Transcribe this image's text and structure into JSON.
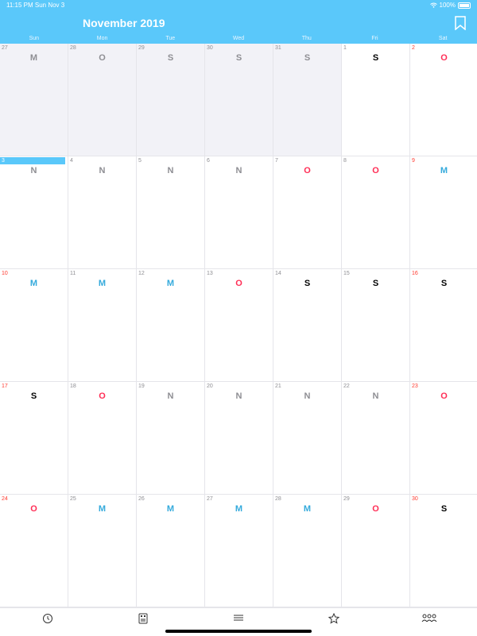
{
  "status": {
    "time": "11:15 PM   Sun Nov 3",
    "battery": "100%"
  },
  "header": {
    "title": "November 2019"
  },
  "weekdays": [
    "Sun",
    "Mon",
    "Tue",
    "Wed",
    "Thu",
    "Fri",
    "Sat"
  ],
  "weeks": [
    [
      {
        "day": "27",
        "shift": "M",
        "prev": true
      },
      {
        "day": "28",
        "shift": "O",
        "prev": true
      },
      {
        "day": "29",
        "shift": "S",
        "prev": true
      },
      {
        "day": "30",
        "shift": "S",
        "prev": true
      },
      {
        "day": "31",
        "shift": "S",
        "prev": true
      },
      {
        "day": "1",
        "shift": "S"
      },
      {
        "day": "2",
        "shift": "O",
        "weekend": true
      }
    ],
    [
      {
        "day": "3",
        "shift": "N",
        "today": true
      },
      {
        "day": "4",
        "shift": "N"
      },
      {
        "day": "5",
        "shift": "N"
      },
      {
        "day": "6",
        "shift": "N"
      },
      {
        "day": "7",
        "shift": "O"
      },
      {
        "day": "8",
        "shift": "O"
      },
      {
        "day": "9",
        "shift": "M",
        "weekend": true
      }
    ],
    [
      {
        "day": "10",
        "shift": "M",
        "weekend": true
      },
      {
        "day": "11",
        "shift": "M"
      },
      {
        "day": "12",
        "shift": "M"
      },
      {
        "day": "13",
        "shift": "O"
      },
      {
        "day": "14",
        "shift": "S"
      },
      {
        "day": "15",
        "shift": "S"
      },
      {
        "day": "16",
        "shift": "S",
        "weekend": true
      }
    ],
    [
      {
        "day": "17",
        "shift": "S",
        "weekend": true
      },
      {
        "day": "18",
        "shift": "O"
      },
      {
        "day": "19",
        "shift": "N"
      },
      {
        "day": "20",
        "shift": "N"
      },
      {
        "day": "21",
        "shift": "N"
      },
      {
        "day": "22",
        "shift": "N"
      },
      {
        "day": "23",
        "shift": "O",
        "weekend": true
      }
    ],
    [
      {
        "day": "24",
        "shift": "O",
        "weekend": true
      },
      {
        "day": "25",
        "shift": "M"
      },
      {
        "day": "26",
        "shift": "M"
      },
      {
        "day": "27",
        "shift": "M"
      },
      {
        "day": "28",
        "shift": "M"
      },
      {
        "day": "29",
        "shift": "O"
      },
      {
        "day": "30",
        "shift": "S",
        "weekend": true
      }
    ]
  ],
  "tabs": [
    {
      "name": "tab-schedule",
      "icon": "clock-icon"
    },
    {
      "name": "tab-shifts",
      "icon": "card-icon"
    },
    {
      "name": "tab-list",
      "icon": "menu-icon"
    },
    {
      "name": "tab-favorites",
      "icon": "star-icon"
    },
    {
      "name": "tab-team",
      "icon": "people-icon"
    }
  ],
  "colors": {
    "accent": "#5ac8fa",
    "shift_M": "#34aadc",
    "shift_O": "#ff2d55",
    "shift_S": "#000000",
    "shift_N": "#8e8e93",
    "weekend": "#ff3b30"
  }
}
